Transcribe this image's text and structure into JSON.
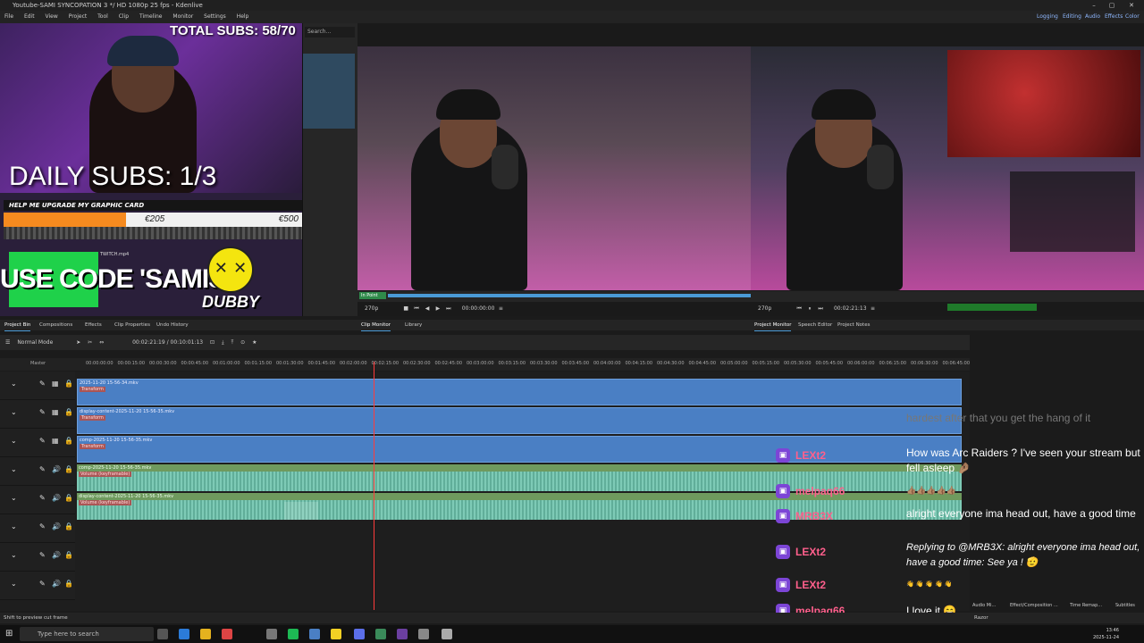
{
  "window": {
    "title": "Youtube-SAMI SYNCOPATION 3 */ HD 1080p 25 fps - Kdenlive",
    "controls": [
      "–",
      "▢",
      "✕"
    ]
  },
  "menu": {
    "items": [
      "File",
      "Edit",
      "View",
      "Project",
      "Tool",
      "Clip",
      "Timeline",
      "Monitor",
      "Settings",
      "Help"
    ],
    "workspaces": [
      "Logging",
      "Editing",
      "Audio",
      "Effects",
      "Color"
    ]
  },
  "overlay": {
    "total_subs": "TOTAL SUBS: 58/70",
    "daily_subs": "DAILY SUBS: 1/3",
    "goal_title": "HELP ME UPGRADE MY GRAPHIC CARD",
    "goal_current": "€205",
    "goal_max": "€500",
    "goal_fraction": 0.41,
    "twitch_file": "TWITCH.mp4",
    "use_code": "USE CODE 'SAMISY'",
    "dubby": "DUBBY",
    "emoji": "✕ ✕"
  },
  "bin": {
    "search_placeholder": "Search..."
  },
  "clip_monitor": {
    "resolution": "270p",
    "timecode": "00:00:00:00",
    "zone_label": "In Point"
  },
  "project_monitor": {
    "resolution": "270p",
    "timecode": "00:02:21:13"
  },
  "panel_tabs": {
    "left": [
      "Project Bin",
      "Compositions",
      "Effects",
      "Clip Properties",
      "Undo History"
    ],
    "middle": [
      "Clip Monitor",
      "Library"
    ],
    "right": [
      "Project Monitor",
      "Speech Editor",
      "Project Notes"
    ]
  },
  "timeline": {
    "mode": "Normal Mode",
    "timecode": "00:02:21:19 / 00:10:01:13",
    "master_label": "Master",
    "ruler": [
      "00:00:00:00",
      "00:00:15:00",
      "00:00:30:00",
      "00:00:45:00",
      "00:01:00:00",
      "00:01:15:00",
      "00:01:30:00",
      "00:01:45:00",
      "00:02:00:00",
      "00:02:15:00",
      "00:02:30:00",
      "00:02:45:00",
      "00:03:00:00",
      "00:03:15:00",
      "00:03:30:00",
      "00:03:45:00",
      "00:04:00:00",
      "00:04:15:00",
      "00:04:30:00",
      "00:04:45:00",
      "00:05:00:00",
      "00:05:15:00",
      "00:05:30:00",
      "00:05:45:00",
      "00:06:00:00",
      "00:06:15:00",
      "00:06:30:00",
      "00:06:45:00"
    ],
    "tracks": [
      {
        "kind": "V",
        "clip": "2025-11-20 15-56-34.mkv",
        "fx": "Transform"
      },
      {
        "kind": "V",
        "clip": "display-content-2025-11-20 15-56-35.mkv",
        "fx": "Transform"
      },
      {
        "kind": "V",
        "clip": "comp-2025-11-20 15-56-35.mkv",
        "fx": "Transform"
      },
      {
        "kind": "A",
        "clip": "comp-2025-11-20 15-56-35.mkv",
        "fx": "Volume (keyframable)"
      },
      {
        "kind": "A",
        "clip": "display-content-2025-11-20 15-56-35.mkv",
        "fx": "Volume (keyframable)"
      },
      {
        "kind": "A",
        "clip": "",
        "fx": ""
      },
      {
        "kind": "A",
        "clip": "",
        "fx": ""
      },
      {
        "kind": "A",
        "clip": "",
        "fx": ""
      }
    ]
  },
  "chat": {
    "faded": "hardest after that you get the hang of it",
    "messages": [
      {
        "name": "LEXt2",
        "text": "How was Arc Raiders ? I've seen your stream but fell asleep 🤌🏽"
      },
      {
        "name": "melpaq66",
        "text": "👍🏽👍🏽👍🏽👍🏽👍🏽"
      },
      {
        "name": "MRB3X",
        "text": "alright everyone ima head out, have a good time"
      },
      {
        "name": "LEXt2",
        "text": "Replying to @MRB3X: alright everyone ima head out, have a good time:  See ya ! 🫡"
      },
      {
        "name": "LEXt2",
        "text": "👋 👋 👋 👋 👋"
      },
      {
        "name": "melpaq66",
        "text": "I love it 😄"
      }
    ]
  },
  "right_panel": {
    "tabs": [
      "Audio Mi...",
      "Effect/Composition ...",
      "Time Remap...",
      "Subtitles"
    ]
  },
  "statusbar": {
    "hint": "Shift to preview cut frame",
    "tool": "Razor"
  },
  "taskbar": {
    "search": "Type here to search",
    "time": "13:46",
    "date": "2025-11-24"
  }
}
